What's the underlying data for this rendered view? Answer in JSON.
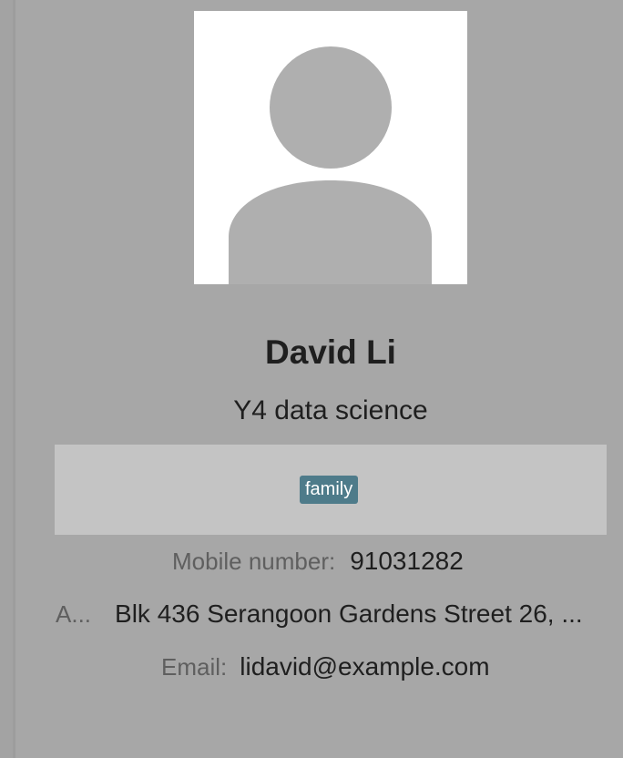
{
  "person": {
    "name": "David Li",
    "subtitle": "Y4 data science",
    "tags": [
      "family"
    ],
    "mobile_label": "Mobile number:",
    "mobile_value": "91031282",
    "address_label": "A...",
    "address_value": "Blk 436 Serangoon Gardens Street 26, ...",
    "email_label": "Email:",
    "email_value": "lidavid@example.com"
  },
  "colors": {
    "background": "#a7a7a7",
    "tag_background": "#4e7b8a",
    "tags_panel": "#c4c4c4"
  }
}
